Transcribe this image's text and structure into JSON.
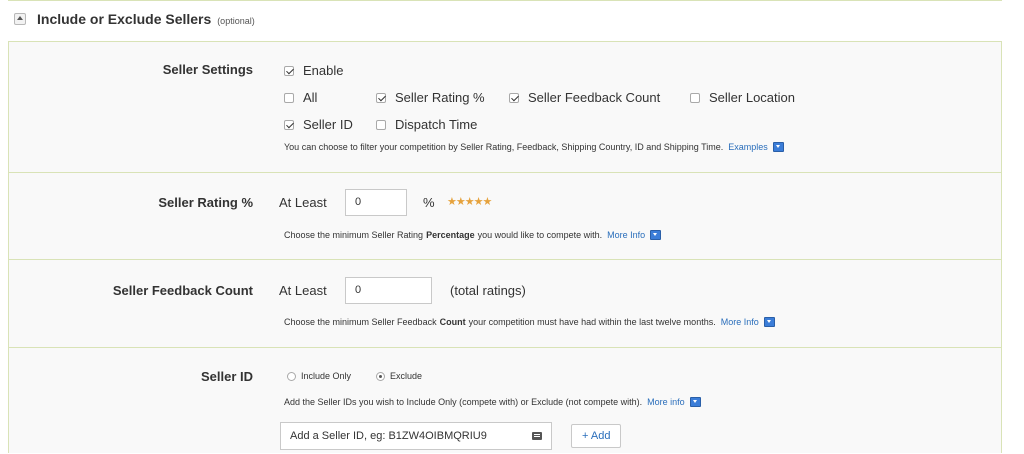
{
  "section": {
    "title": "Include or Exclude Sellers",
    "optional": "(optional)"
  },
  "seller_settings": {
    "label": "Seller Settings",
    "options": [
      {
        "key": "enable",
        "label": "Enable",
        "checked": true
      },
      {
        "key": "all",
        "label": "All",
        "checked": false
      },
      {
        "key": "seller_rating",
        "label": "Seller Rating %",
        "checked": true
      },
      {
        "key": "seller_feedback_count",
        "label": "Seller Feedback Count",
        "checked": true
      },
      {
        "key": "seller_location",
        "label": "Seller Location",
        "checked": false
      },
      {
        "key": "seller_id",
        "label": "Seller ID",
        "checked": true
      },
      {
        "key": "dispatch_time",
        "label": "Dispatch Time",
        "checked": false
      }
    ],
    "help": "You can choose to filter your competition by Seller Rating, Feedback, Shipping Country, ID and Shipping Time.",
    "help_link": "Examples"
  },
  "seller_rating": {
    "label": "Seller Rating %",
    "prefix": "At Least",
    "value": "0",
    "suffix": "%",
    "stars": "★★★★★",
    "help_before": "Choose the minimum Seller Rating",
    "help_bold": "Percentage",
    "help_after": "you would like to compete with.",
    "help_link": "More Info"
  },
  "seller_feedback": {
    "label": "Seller Feedback Count",
    "prefix": "At Least",
    "value": "0",
    "suffix": "(total ratings)",
    "help_before": "Choose the minimum Seller Feedback",
    "help_bold": "Count",
    "help_after": "your competition must have had within the last twelve months.",
    "help_link": "More Info"
  },
  "seller_id": {
    "label": "Seller ID",
    "radio_include": "Include Only",
    "radio_exclude": "Exclude",
    "selected": "exclude",
    "help": "Add the Seller IDs you wish to Include Only (compete with) or Exclude (not compete with).",
    "help_link": "More info",
    "input_placeholder": "Add a Seller ID, eg: B1ZW4OIBMQRIU9",
    "add_button": "+ Add"
  }
}
